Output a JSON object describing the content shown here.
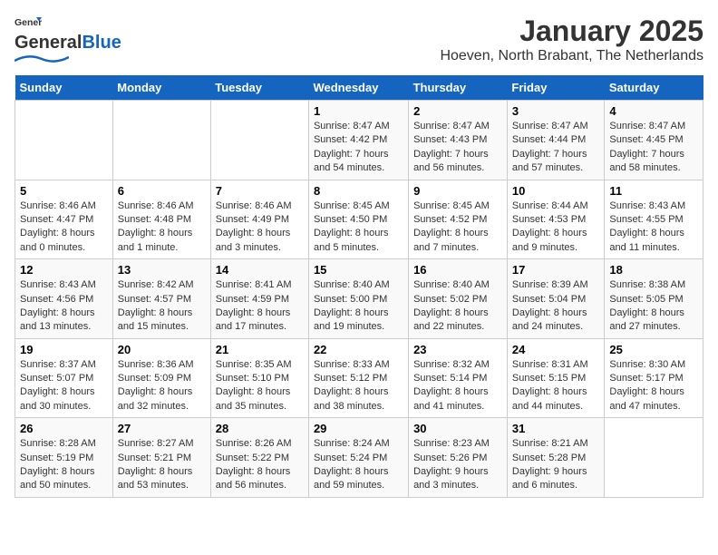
{
  "logo": {
    "line1": "General",
    "line2": "Blue"
  },
  "title": "January 2025",
  "location": "Hoeven, North Brabant, The Netherlands",
  "days_of_week": [
    "Sunday",
    "Monday",
    "Tuesday",
    "Wednesday",
    "Thursday",
    "Friday",
    "Saturday"
  ],
  "weeks": [
    [
      {
        "day": "",
        "info": ""
      },
      {
        "day": "",
        "info": ""
      },
      {
        "day": "",
        "info": ""
      },
      {
        "day": "1",
        "info": "Sunrise: 8:47 AM\nSunset: 4:42 PM\nDaylight: 7 hours\nand 54 minutes."
      },
      {
        "day": "2",
        "info": "Sunrise: 8:47 AM\nSunset: 4:43 PM\nDaylight: 7 hours\nand 56 minutes."
      },
      {
        "day": "3",
        "info": "Sunrise: 8:47 AM\nSunset: 4:44 PM\nDaylight: 7 hours\nand 57 minutes."
      },
      {
        "day": "4",
        "info": "Sunrise: 8:47 AM\nSunset: 4:45 PM\nDaylight: 7 hours\nand 58 minutes."
      }
    ],
    [
      {
        "day": "5",
        "info": "Sunrise: 8:46 AM\nSunset: 4:47 PM\nDaylight: 8 hours\nand 0 minutes."
      },
      {
        "day": "6",
        "info": "Sunrise: 8:46 AM\nSunset: 4:48 PM\nDaylight: 8 hours\nand 1 minute."
      },
      {
        "day": "7",
        "info": "Sunrise: 8:46 AM\nSunset: 4:49 PM\nDaylight: 8 hours\nand 3 minutes."
      },
      {
        "day": "8",
        "info": "Sunrise: 8:45 AM\nSunset: 4:50 PM\nDaylight: 8 hours\nand 5 minutes."
      },
      {
        "day": "9",
        "info": "Sunrise: 8:45 AM\nSunset: 4:52 PM\nDaylight: 8 hours\nand 7 minutes."
      },
      {
        "day": "10",
        "info": "Sunrise: 8:44 AM\nSunset: 4:53 PM\nDaylight: 8 hours\nand 9 minutes."
      },
      {
        "day": "11",
        "info": "Sunrise: 8:43 AM\nSunset: 4:55 PM\nDaylight: 8 hours\nand 11 minutes."
      }
    ],
    [
      {
        "day": "12",
        "info": "Sunrise: 8:43 AM\nSunset: 4:56 PM\nDaylight: 8 hours\nand 13 minutes."
      },
      {
        "day": "13",
        "info": "Sunrise: 8:42 AM\nSunset: 4:57 PM\nDaylight: 8 hours\nand 15 minutes."
      },
      {
        "day": "14",
        "info": "Sunrise: 8:41 AM\nSunset: 4:59 PM\nDaylight: 8 hours\nand 17 minutes."
      },
      {
        "day": "15",
        "info": "Sunrise: 8:40 AM\nSunset: 5:00 PM\nDaylight: 8 hours\nand 19 minutes."
      },
      {
        "day": "16",
        "info": "Sunrise: 8:40 AM\nSunset: 5:02 PM\nDaylight: 8 hours\nand 22 minutes."
      },
      {
        "day": "17",
        "info": "Sunrise: 8:39 AM\nSunset: 5:04 PM\nDaylight: 8 hours\nand 24 minutes."
      },
      {
        "day": "18",
        "info": "Sunrise: 8:38 AM\nSunset: 5:05 PM\nDaylight: 8 hours\nand 27 minutes."
      }
    ],
    [
      {
        "day": "19",
        "info": "Sunrise: 8:37 AM\nSunset: 5:07 PM\nDaylight: 8 hours\nand 30 minutes."
      },
      {
        "day": "20",
        "info": "Sunrise: 8:36 AM\nSunset: 5:09 PM\nDaylight: 8 hours\nand 32 minutes."
      },
      {
        "day": "21",
        "info": "Sunrise: 8:35 AM\nSunset: 5:10 PM\nDaylight: 8 hours\nand 35 minutes."
      },
      {
        "day": "22",
        "info": "Sunrise: 8:33 AM\nSunset: 5:12 PM\nDaylight: 8 hours\nand 38 minutes."
      },
      {
        "day": "23",
        "info": "Sunrise: 8:32 AM\nSunset: 5:14 PM\nDaylight: 8 hours\nand 41 minutes."
      },
      {
        "day": "24",
        "info": "Sunrise: 8:31 AM\nSunset: 5:15 PM\nDaylight: 8 hours\nand 44 minutes."
      },
      {
        "day": "25",
        "info": "Sunrise: 8:30 AM\nSunset: 5:17 PM\nDaylight: 8 hours\nand 47 minutes."
      }
    ],
    [
      {
        "day": "26",
        "info": "Sunrise: 8:28 AM\nSunset: 5:19 PM\nDaylight: 8 hours\nand 50 minutes."
      },
      {
        "day": "27",
        "info": "Sunrise: 8:27 AM\nSunset: 5:21 PM\nDaylight: 8 hours\nand 53 minutes."
      },
      {
        "day": "28",
        "info": "Sunrise: 8:26 AM\nSunset: 5:22 PM\nDaylight: 8 hours\nand 56 minutes."
      },
      {
        "day": "29",
        "info": "Sunrise: 8:24 AM\nSunset: 5:24 PM\nDaylight: 8 hours\nand 59 minutes."
      },
      {
        "day": "30",
        "info": "Sunrise: 8:23 AM\nSunset: 5:26 PM\nDaylight: 9 hours\nand 3 minutes."
      },
      {
        "day": "31",
        "info": "Sunrise: 8:21 AM\nSunset: 5:28 PM\nDaylight: 9 hours\nand 6 minutes."
      },
      {
        "day": "",
        "info": ""
      }
    ]
  ]
}
